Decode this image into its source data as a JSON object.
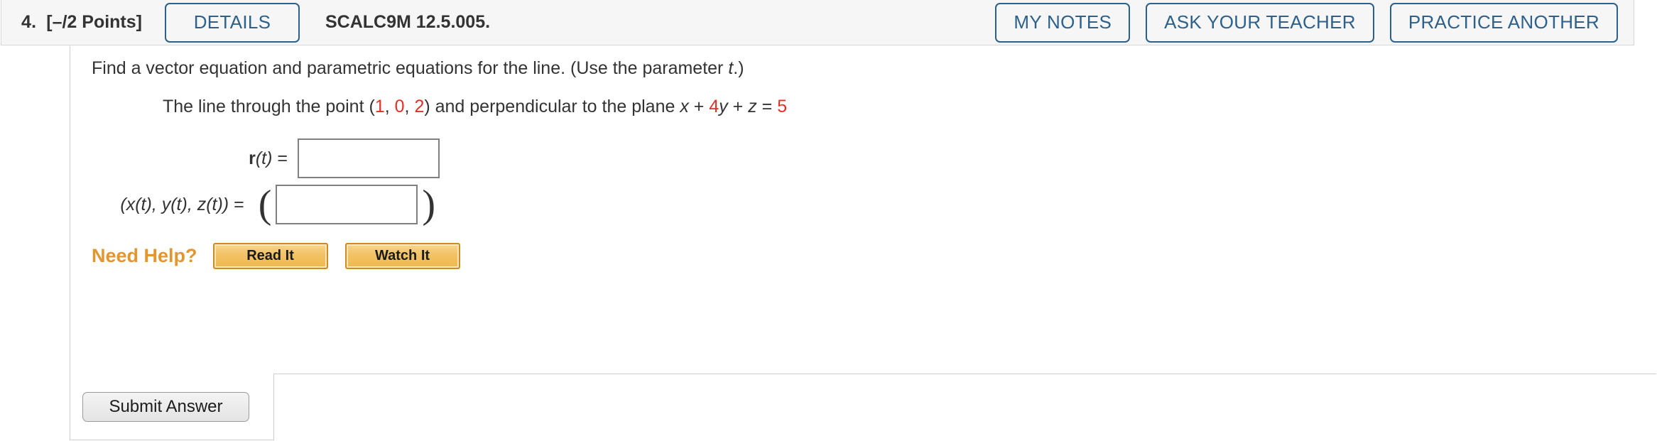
{
  "header": {
    "question_number": "4.",
    "points": "[–/2 Points]",
    "details_label": "DETAILS",
    "problem_code": "SCALC9M 12.5.005.",
    "my_notes_label": "MY NOTES",
    "ask_teacher_label": "ASK YOUR TEACHER",
    "practice_another_label": "PRACTICE ANOTHER",
    "accent_color": "#2b618c",
    "background_color": "#f6f6f6"
  },
  "question": {
    "prompt_part1": "Find a vector equation and parametric equations for the line. (Use the parameter ",
    "prompt_param": "t",
    "prompt_part2": ".)",
    "statement": {
      "lead": "The line through the point (",
      "point_x": "1",
      "sep1": ", ",
      "point_y": "0",
      "sep2": ", ",
      "point_z": "2",
      "mid": ") and perpendicular to the plane ",
      "var_x": "x",
      "plus1": " + ",
      "coef_y": "4",
      "var_y": "y",
      "plus2": " + ",
      "var_z": "z",
      "equals": " = ",
      "rhs": "5"
    },
    "highlight_color": "#e03127"
  },
  "answers": [
    {
      "label_vec": "r",
      "label_arg": "(t)",
      "label_eq": " = ",
      "value": "",
      "placeholder": ""
    },
    {
      "label_full": "(x(t), y(t), z(t))",
      "label_eq": " = ",
      "value": "",
      "placeholder": "",
      "open_paren": "(",
      "close_paren": ")"
    }
  ],
  "need_help": {
    "label": "Need Help?",
    "read_it_label": "Read It",
    "watch_it_label": "Watch It",
    "label_color": "#e3962f"
  },
  "submit": {
    "label": "Submit Answer"
  }
}
